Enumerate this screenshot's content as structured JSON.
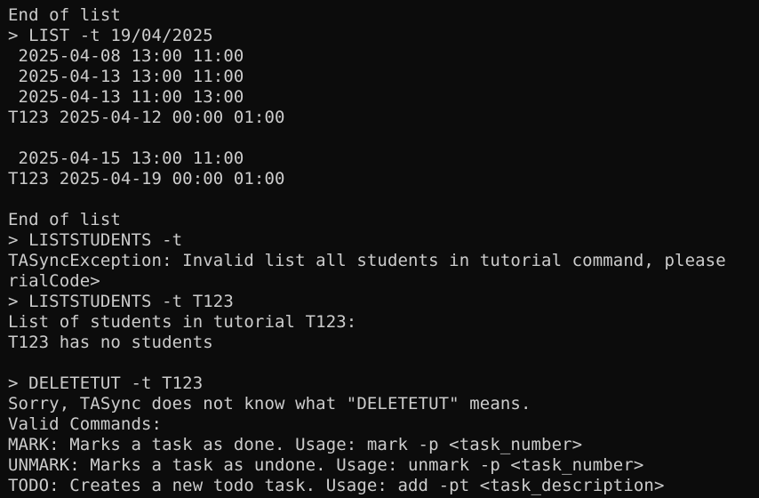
{
  "terminal": {
    "text_color": "#cccccc",
    "background_color": "#0c0c0c",
    "lines": [
      "End of list",
      "> LIST -t 19/04/2025",
      " 2025-04-08 13:00 11:00",
      " 2025-04-13 13:00 11:00",
      " 2025-04-13 11:00 13:00",
      "T123 2025-04-12 00:00 01:00",
      "",
      " 2025-04-15 13:00 11:00",
      "T123 2025-04-19 00:00 01:00",
      "",
      "End of list",
      "> LISTSTUDENTS -t",
      "TASyncException: Invalid list all students in tutorial command, please",
      "rialCode>",
      "> LISTSTUDENTS -t T123",
      "List of students in tutorial T123:",
      "T123 has no students",
      "",
      "> DELETETUT -t T123",
      "Sorry, TASync does not know what \"DELETETUT\" means.",
      "Valid Commands:",
      "MARK: Marks a task as done. Usage: mark -p <task_number>",
      "UNMARK: Marks a task as undone. Usage: unmark -p <task_number>",
      "TODO: Creates a new todo task. Usage: add -pt <task_description>"
    ]
  }
}
